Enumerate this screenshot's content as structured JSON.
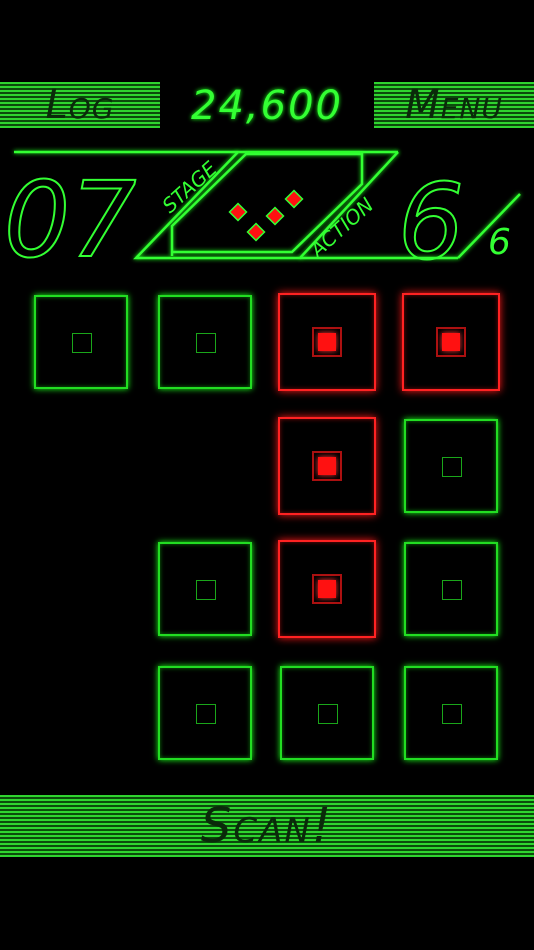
{
  "header": {
    "log_label": "Log",
    "score": "24,600",
    "menu_label": "Menu"
  },
  "hud": {
    "stage_label": "STAGE",
    "stage_number": "07",
    "action_label": "ACTION",
    "actions_left": "6",
    "actions_total": "6"
  },
  "grid": {
    "rows": [
      [
        "off",
        "off",
        "on",
        "on"
      ],
      [
        "empty",
        "empty",
        "on",
        "off"
      ],
      [
        "empty",
        "off",
        "on",
        "off"
      ],
      [
        "empty",
        "off",
        "off",
        "off"
      ]
    ]
  },
  "footer": {
    "scan_label": "Scan!"
  },
  "colors": {
    "accent_green": "#33ff33",
    "lit_red": "#ff1111"
  }
}
